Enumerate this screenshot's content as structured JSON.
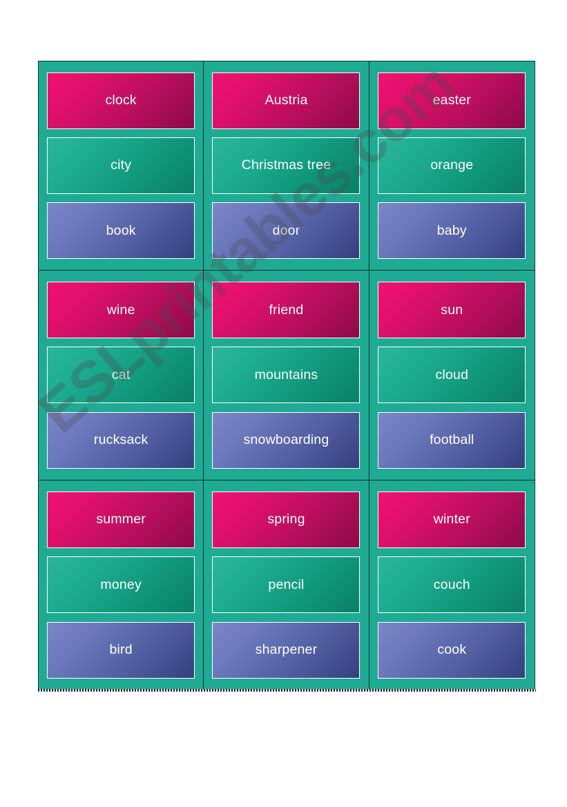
{
  "document": {
    "kind": "esl-vocabulary-flashcards-worksheet",
    "page_background": "#ffffff",
    "panel_background": "#1fab93"
  },
  "watermark": {
    "text": "ESLprintables.com",
    "color": "#4a4a4a",
    "rotation_deg": -41
  },
  "palette": {
    "teal_panel": "#1fab93",
    "card_pink_start": "#ef1272",
    "card_pink_end": "#8d0a48",
    "card_green_start": "#2bb59a",
    "card_green_end": "#0a7f66",
    "card_blue_start": "#7b86c8",
    "card_blue_end": "#343f7e",
    "card_border": "#ffffff",
    "divider": "#0d2b27",
    "text": "#ffffff"
  },
  "grid": {
    "columns": 3,
    "rows": 3,
    "groups": [
      {
        "id": "group-1",
        "cards": [
          {
            "label": "clock",
            "color": "pink"
          },
          {
            "label": "city",
            "color": "green"
          },
          {
            "label": "book",
            "color": "blue"
          }
        ]
      },
      {
        "id": "group-2",
        "cards": [
          {
            "label": "Austria",
            "color": "pink"
          },
          {
            "label": "Christmas tree",
            "color": "green"
          },
          {
            "label": "door",
            "color": "blue"
          }
        ]
      },
      {
        "id": "group-3",
        "cards": [
          {
            "label": "easter",
            "color": "pink"
          },
          {
            "label": "orange",
            "color": "green"
          },
          {
            "label": "baby",
            "color": "blue"
          }
        ]
      },
      {
        "id": "group-4",
        "cards": [
          {
            "label": "wine",
            "color": "pink"
          },
          {
            "label": "cat",
            "color": "green"
          },
          {
            "label": "rucksack",
            "color": "blue"
          }
        ]
      },
      {
        "id": "group-5",
        "cards": [
          {
            "label": "friend",
            "color": "pink"
          },
          {
            "label": "mountains",
            "color": "green"
          },
          {
            "label": "snowboarding",
            "color": "blue"
          }
        ]
      },
      {
        "id": "group-6",
        "cards": [
          {
            "label": "sun",
            "color": "pink"
          },
          {
            "label": "cloud",
            "color": "green"
          },
          {
            "label": "football",
            "color": "blue"
          }
        ]
      },
      {
        "id": "group-7",
        "cards": [
          {
            "label": "summer",
            "color": "pink"
          },
          {
            "label": "money",
            "color": "green"
          },
          {
            "label": "bird",
            "color": "blue"
          }
        ]
      },
      {
        "id": "group-8",
        "cards": [
          {
            "label": "spring",
            "color": "pink"
          },
          {
            "label": "pencil",
            "color": "green"
          },
          {
            "label": "sharpener",
            "color": "blue"
          }
        ]
      },
      {
        "id": "group-9",
        "cards": [
          {
            "label": "winter",
            "color": "pink"
          },
          {
            "label": "couch",
            "color": "green"
          },
          {
            "label": "cook",
            "color": "blue"
          }
        ]
      }
    ]
  }
}
